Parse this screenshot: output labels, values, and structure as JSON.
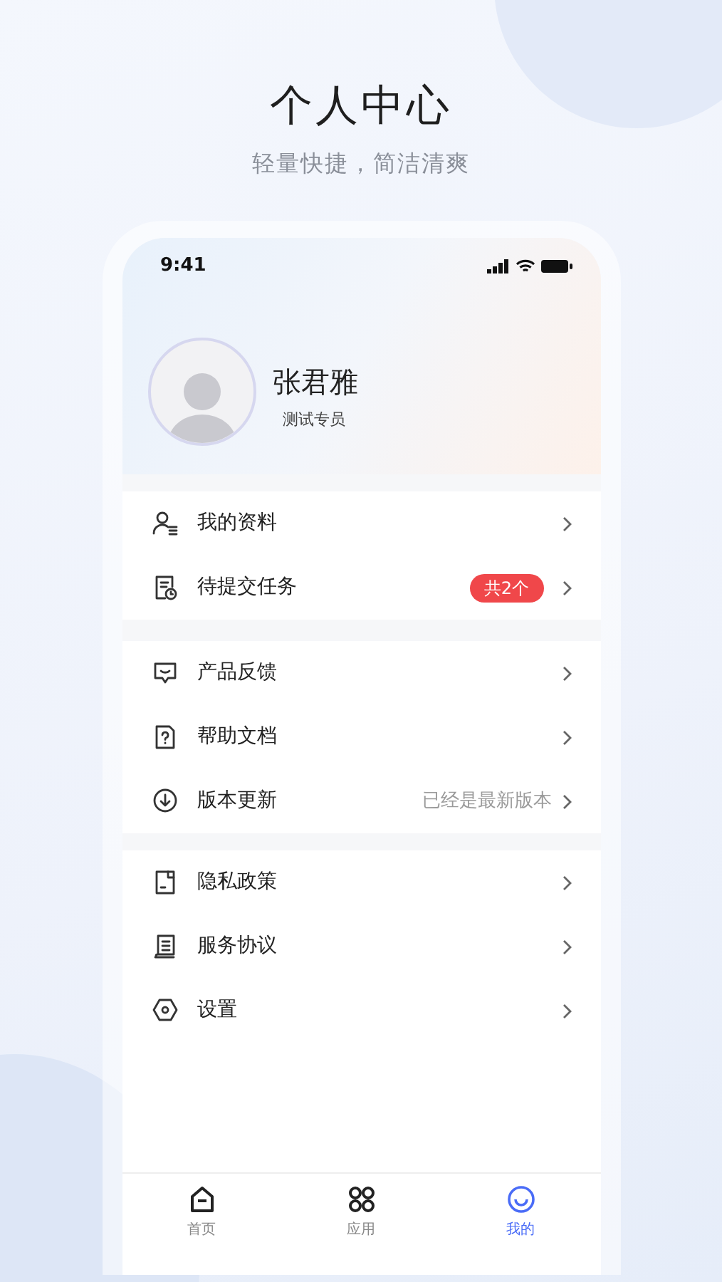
{
  "header": {
    "title": "个人中心",
    "subtitle": "轻量快捷，简洁清爽"
  },
  "status_bar": {
    "time": "9:41"
  },
  "profile": {
    "name": "张君雅",
    "role": "测试专员"
  },
  "menu_groups": [
    {
      "items": [
        {
          "label": "我的资料"
        },
        {
          "label": "待提交任务",
          "badge": "共2个"
        }
      ]
    },
    {
      "items": [
        {
          "label": "产品反馈"
        },
        {
          "label": "帮助文档"
        },
        {
          "label": "版本更新",
          "value": "已经是最新版本"
        }
      ]
    },
    {
      "items": [
        {
          "label": "隐私政策"
        },
        {
          "label": "服务协议"
        },
        {
          "label": "设置"
        }
      ]
    }
  ],
  "tab_bar": [
    {
      "label": "首页",
      "selected": false
    },
    {
      "label": "应用",
      "selected": false
    },
    {
      "label": "我的",
      "selected": true
    }
  ]
}
